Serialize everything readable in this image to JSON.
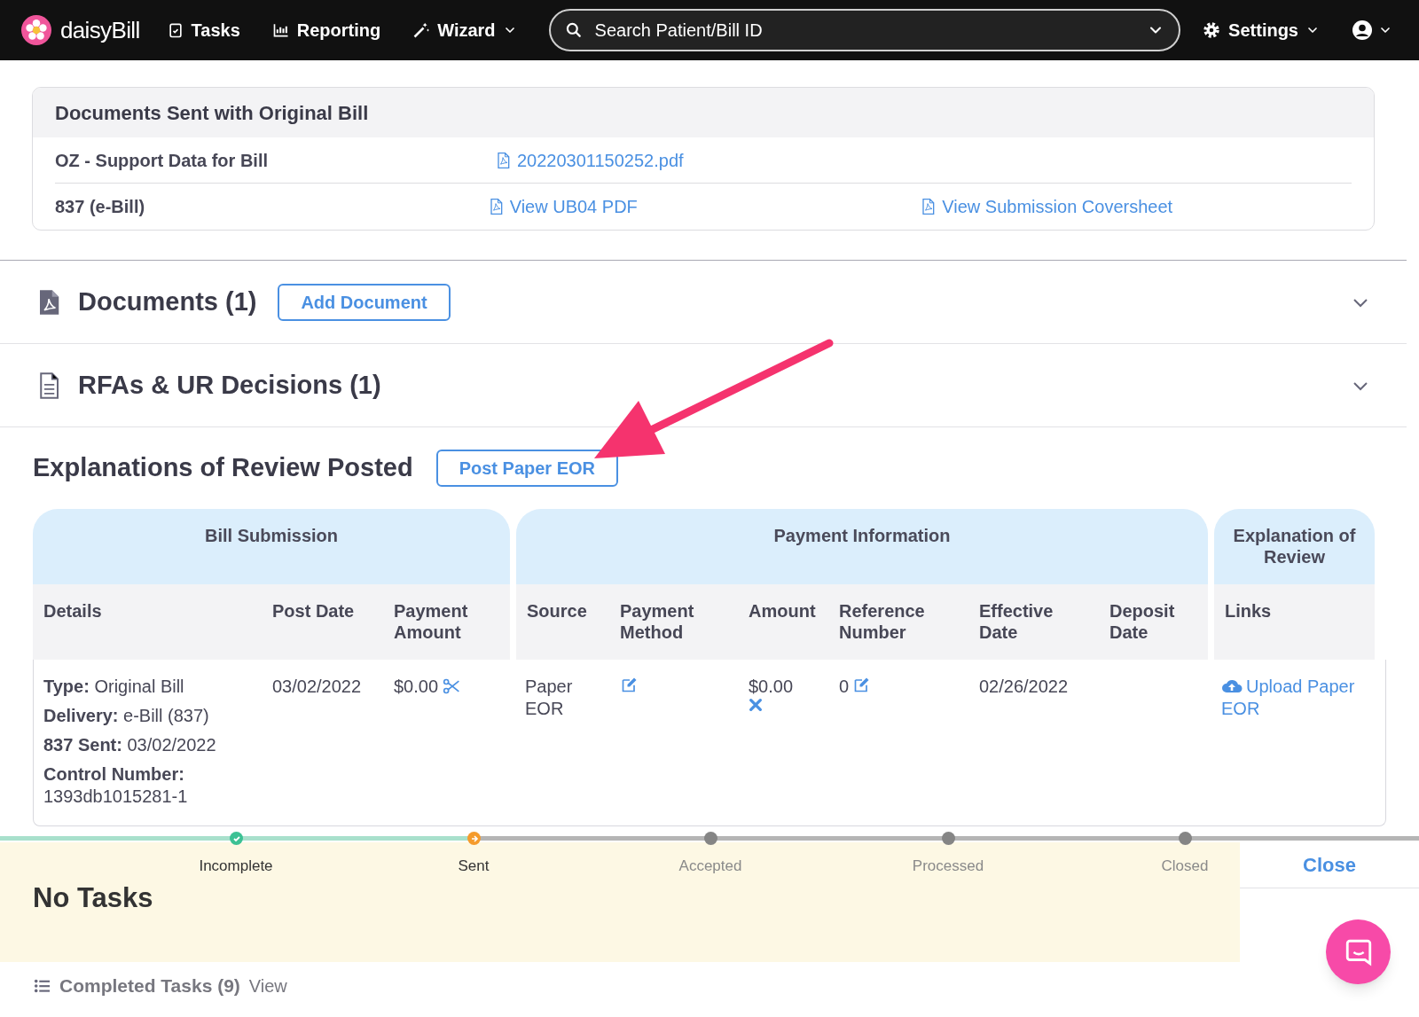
{
  "nav": {
    "logo": "daisyBill",
    "items": [
      {
        "label": "Tasks",
        "dropdown": false
      },
      {
        "label": "Reporting",
        "dropdown": false
      },
      {
        "label": "Wizard",
        "dropdown": true
      }
    ],
    "search": {
      "placeholder": "Search Patient/Bill ID"
    },
    "settings": "Settings"
  },
  "documents_sent": {
    "title": "Documents Sent with Original Bill",
    "rows": [
      {
        "label": "OZ - Support Data for Bill",
        "links": [
          "20220301150252.pdf"
        ]
      },
      {
        "label": "837 (e-Bill)",
        "links": [
          "View UB04 PDF",
          "View Submission Coversheet"
        ]
      }
    ]
  },
  "sections": [
    {
      "title": "Documents (1)",
      "button": "Add Document",
      "expanded": false
    },
    {
      "title": "RFAs & UR Decisions (1)",
      "expanded": false
    }
  ],
  "eor": {
    "title": "Explanations of Review Posted",
    "button": "Post Paper EOR",
    "groups": [
      {
        "title": "Bill Submission",
        "columns": [
          "Details",
          "Post Date",
          "Payment Amount"
        ]
      },
      {
        "title": "Payment Information",
        "columns": [
          "Source",
          "Payment Method",
          "Amount",
          "Reference Number",
          "Effective Date",
          "Deposit Date"
        ]
      },
      {
        "title": "Explanation of Review",
        "columns": [
          "Links"
        ]
      }
    ],
    "row": {
      "details": [
        "**Type:** Original Bill",
        "**Delivery:** e-Bill (837)",
        "**837 Sent:** 03/02/2022",
        "**Control Number:** 1393db1015281-1"
      ],
      "post_date": "03/02/2022",
      "payment_amount": "$0.00",
      "source": "Paper EOR",
      "amount": "$0.00",
      "reference_number": "0",
      "effective_date": "02/26/2022",
      "link": "Upload Paper EOR"
    }
  },
  "progress": [
    {
      "label": "Incomplete",
      "kind": "done"
    },
    {
      "label": "Sent",
      "kind": "current"
    },
    {
      "label": "Accepted",
      "kind": "pending"
    },
    {
      "label": "Processed",
      "kind": "pending"
    },
    {
      "label": "Closed",
      "kind": "pending"
    }
  ],
  "tasks": {
    "title": "No Tasks",
    "close": "Close",
    "completed": "Completed Tasks (9)",
    "view": "View"
  }
}
